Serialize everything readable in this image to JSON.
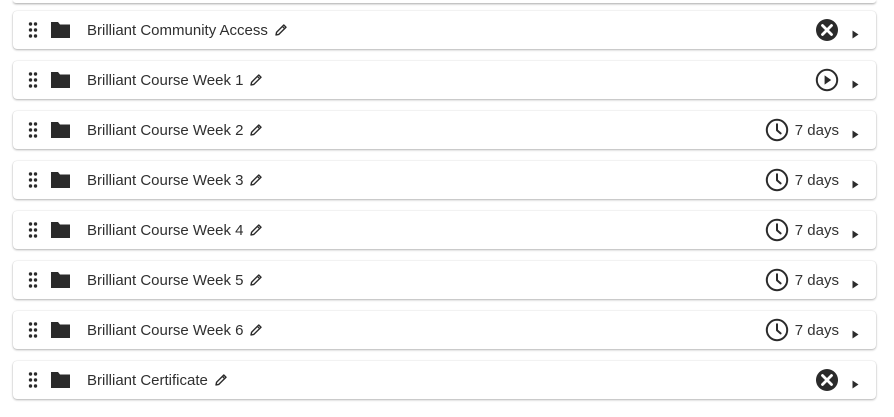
{
  "modules": [
    {
      "title": "Brilliant Community Access",
      "status": "closed-icon",
      "days": ""
    },
    {
      "title": "Brilliant Course Week 1",
      "status": "play-icon",
      "days": ""
    },
    {
      "title": "Brilliant Course Week 2",
      "status": "clock-icon",
      "days": "7 days"
    },
    {
      "title": "Brilliant Course Week 3",
      "status": "clock-icon",
      "days": "7 days"
    },
    {
      "title": "Brilliant Course Week 4",
      "status": "clock-icon",
      "days": "7 days"
    },
    {
      "title": "Brilliant Course Week 5",
      "status": "clock-icon",
      "days": "7 days"
    },
    {
      "title": "Brilliant Course Week 6",
      "status": "clock-icon",
      "days": "7 days"
    },
    {
      "title": "Brilliant Certificate",
      "status": "closed-icon",
      "days": ""
    }
  ],
  "colors": {
    "icon": "#2b2b2b",
    "text": "#2f2f2f"
  }
}
